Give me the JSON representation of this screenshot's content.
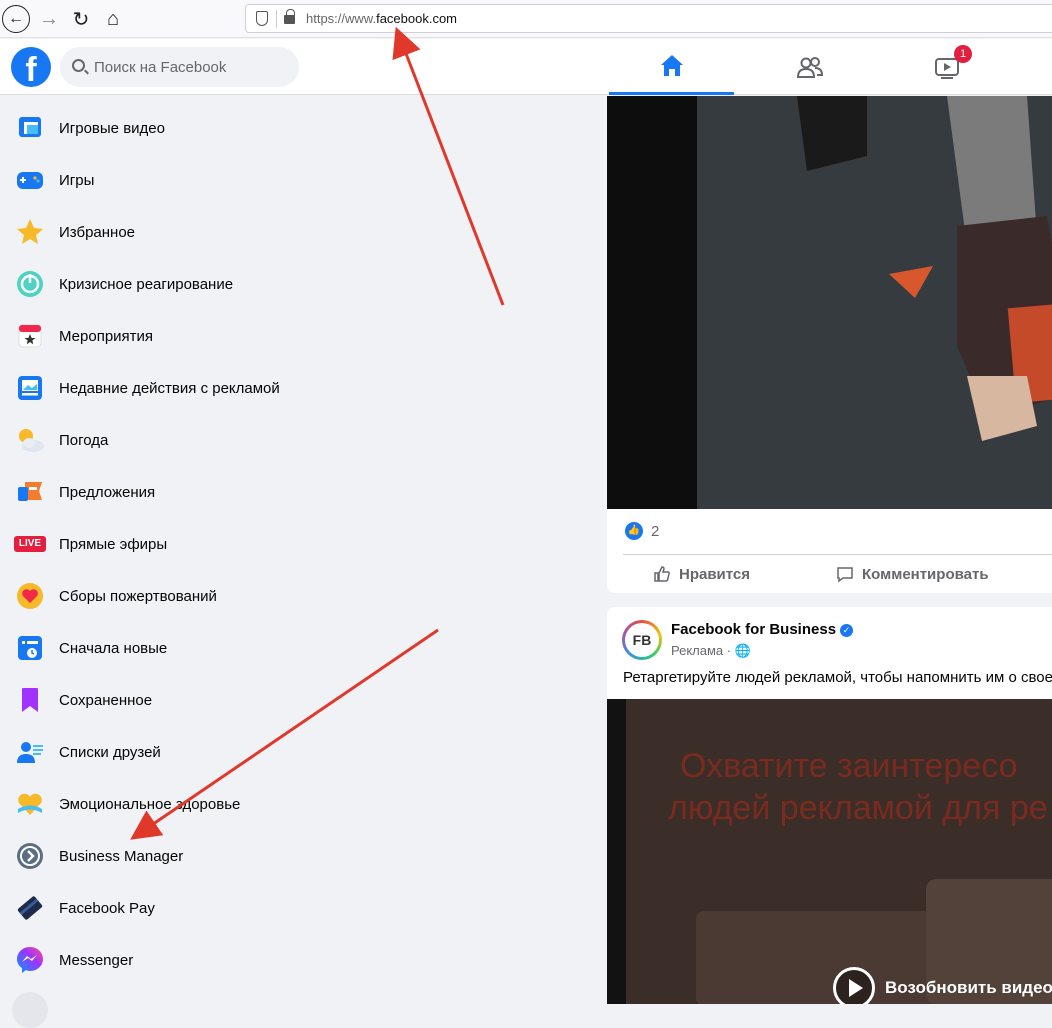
{
  "browser": {
    "url_prefix": "https://www.",
    "url_domain": "facebook.com"
  },
  "header": {
    "logo": "f",
    "search_placeholder": "Поиск на Facebook",
    "watch_badge": "1"
  },
  "sidebar": {
    "items": [
      {
        "label": "Игровые видео",
        "icon": "gaming-video-icon"
      },
      {
        "label": "Игры",
        "icon": "games-icon"
      },
      {
        "label": "Избранное",
        "icon": "favorites-star-icon"
      },
      {
        "label": "Кризисное реагирование",
        "icon": "crisis-response-icon"
      },
      {
        "label": "Мероприятия",
        "icon": "events-calendar-icon"
      },
      {
        "label": "Недавние действия с рекламой",
        "icon": "ad-activity-icon"
      },
      {
        "label": "Погода",
        "icon": "weather-icon"
      },
      {
        "label": "Предложения",
        "icon": "offers-icon"
      },
      {
        "label": "Прямые эфиры",
        "icon": "live-icon"
      },
      {
        "label": "Сборы пожертвований",
        "icon": "fundraisers-icon"
      },
      {
        "label": "Сначала новые",
        "icon": "most-recent-icon"
      },
      {
        "label": "Сохраненное",
        "icon": "saved-bookmark-icon"
      },
      {
        "label": "Списки друзей",
        "icon": "friend-lists-icon"
      },
      {
        "label": "Эмоциональное здоровье",
        "icon": "emotional-health-icon"
      },
      {
        "label": "Business Manager",
        "icon": "business-manager-icon"
      },
      {
        "label": "Facebook Pay",
        "icon": "facebook-pay-icon"
      },
      {
        "label": "Messenger",
        "icon": "messenger-icon"
      }
    ],
    "live_badge": "LIVE"
  },
  "feed": {
    "post1": {
      "reaction_count": "2",
      "like_label": "Нравится",
      "comment_label": "Комментировать"
    },
    "post2": {
      "avatar_text": "FB",
      "page_name": "Facebook for Business",
      "sponsored": "Реклама · ",
      "text": "Ретаргетируйте людей рекламой, чтобы напомнить им о свое",
      "video_line1": "Охватите заинтересо",
      "video_line2": "людей рекламой для ре",
      "resume_label": "Возобновить видео"
    }
  },
  "colors": {
    "brand": "#1877f2",
    "badge": "#e41e3f",
    "annotation_arrow": "#e0392b"
  }
}
